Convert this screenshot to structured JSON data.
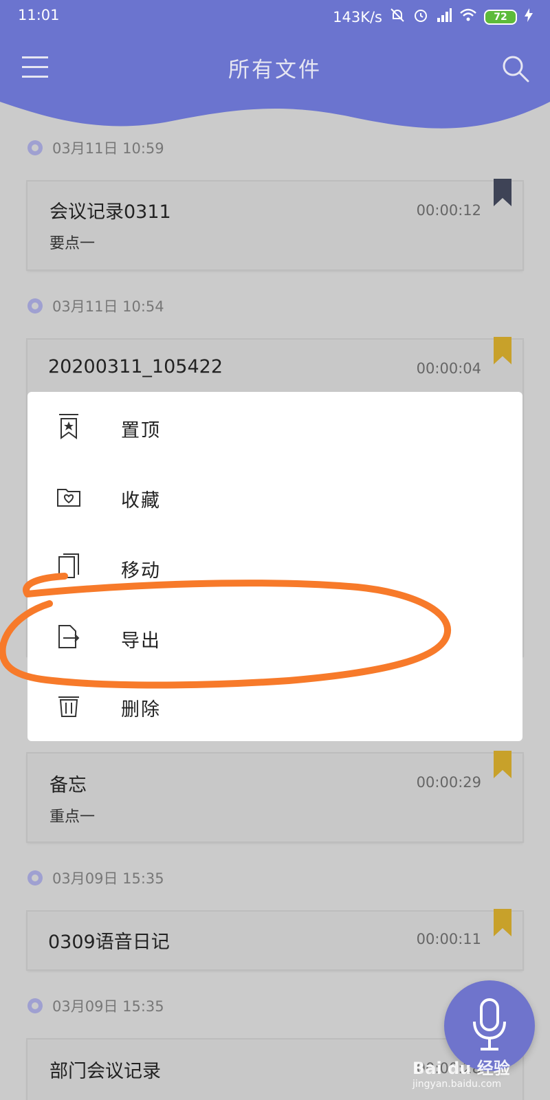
{
  "status": {
    "time": "11:01",
    "speed": "143K/s",
    "battery": "72"
  },
  "header": {
    "title": "所有文件"
  },
  "colors": {
    "header_bg": "#6b74cf",
    "bookmark_dark": "#3e4356",
    "bookmark_gold": "#c8a12a",
    "annotation": "#f77a2a"
  },
  "groups": [
    {
      "date": "03月11日 10:59"
    },
    {
      "date": "03月11日 10:54"
    },
    {
      "date": "03月09日 15:35"
    },
    {
      "date": "03月09日 15:35"
    }
  ],
  "cards": [
    {
      "title": "会议记录0311",
      "sub": "要点一",
      "duration": "00:00:12",
      "bookmark": "dark"
    },
    {
      "title": "20200311_105422",
      "sub": "",
      "duration": "00:00:04",
      "bookmark": "gold"
    },
    {
      "title": "备忘",
      "sub": "重点一",
      "duration": "00:00:29",
      "bookmark": "gold"
    },
    {
      "title": "0309语音日记",
      "sub": "",
      "duration": "00:00:11",
      "bookmark": "gold"
    },
    {
      "title": "部门会议记录",
      "sub": "",
      "duration": "00:00:28",
      "bookmark": "gold"
    }
  ],
  "context_menu": {
    "items": [
      {
        "label": "置顶",
        "icon": "pin-top-icon"
      },
      {
        "label": "收藏",
        "icon": "favorite-folder-icon"
      },
      {
        "label": "移动",
        "icon": "move-icon"
      },
      {
        "label": "导出",
        "icon": "export-icon"
      },
      {
        "label": "删除",
        "icon": "trash-icon"
      }
    ]
  },
  "watermark": {
    "brand": "Bai du 经验",
    "url": "jingyan.baidu.com"
  }
}
